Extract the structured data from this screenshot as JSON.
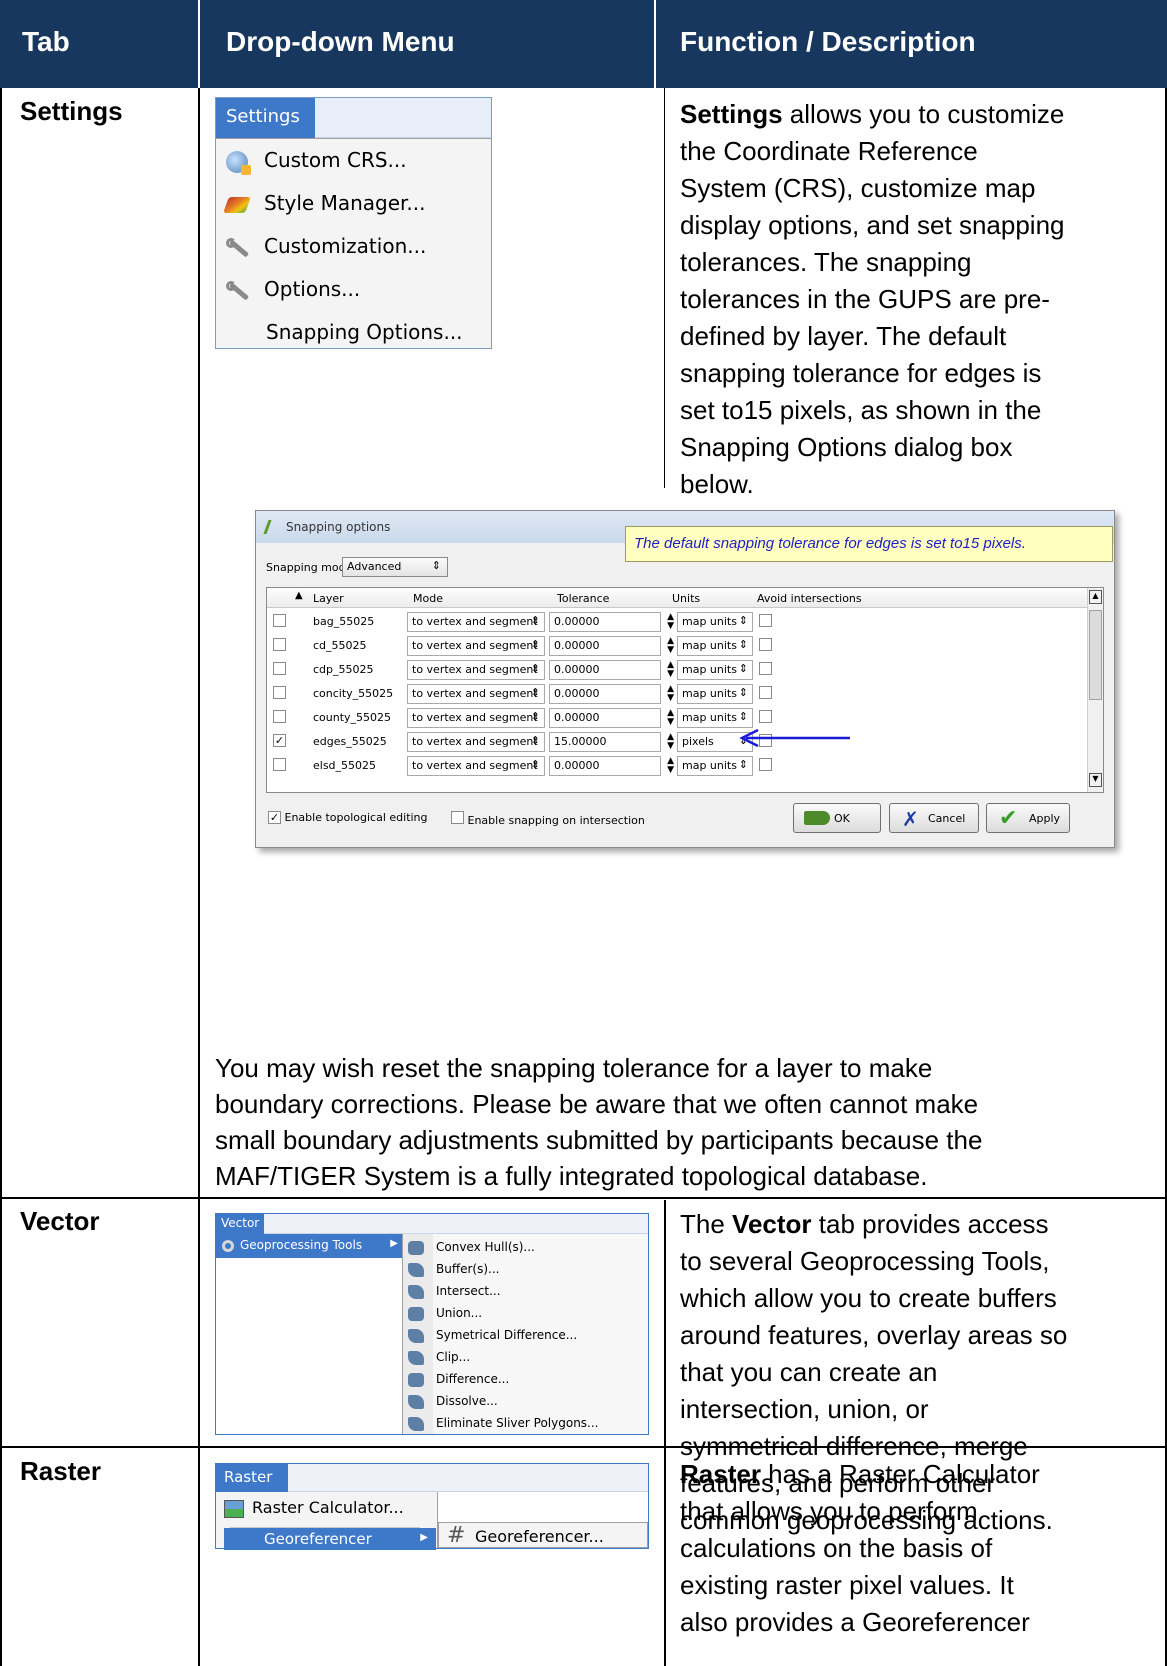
{
  "header": {
    "col1": "Tab",
    "col2": "Drop-down Menu",
    "col3": "Function / Description",
    "bg_color": "#17375e"
  },
  "settings_row": {
    "tab": "Settings",
    "menu_title": "Settings",
    "menu_items": [
      {
        "label": "Custom CRS...",
        "icon": "globe-crs-icon"
      },
      {
        "label": "Style Manager...",
        "icon": "paintbrush-icon"
      },
      {
        "label": "Customization...",
        "icon": "wrench-icon"
      },
      {
        "label": "Options...",
        "icon": "wrench-icon"
      },
      {
        "label": "Snapping Options...",
        "icon": ""
      }
    ],
    "desc_bold": "Settings",
    "desc_lines": [
      " allows you to customize",
      "the Coordinate Reference",
      "System (CRS), customize map",
      "display options, and set snapping",
      "tolerances. The snapping",
      "tolerances in the GUPS are pre-",
      "defined by layer. The default",
      "snapping tolerance for edges is",
      "set to15 pixels, as shown in the",
      "Snapping Options dialog box",
      "below."
    ],
    "dialog": {
      "title": "Snapping options",
      "callout": "The default snapping tolerance for edges is set to15 pixels.",
      "snapping_mode_label": "Snapping mode",
      "snapping_mode_value": "Advanced",
      "columns": [
        "Layer",
        "Mode",
        "Tolerance",
        "Units",
        "Avoid intersections"
      ],
      "rows": [
        {
          "checked": false,
          "layer": "bag_55025",
          "mode": "to vertex and segment",
          "tolerance": "0.00000",
          "units": "map units"
        },
        {
          "checked": false,
          "layer": "cd_55025",
          "mode": "to vertex and segment",
          "tolerance": "0.00000",
          "units": "map units"
        },
        {
          "checked": false,
          "layer": "cdp_55025",
          "mode": "to vertex and segment",
          "tolerance": "0.00000",
          "units": "map units"
        },
        {
          "checked": false,
          "layer": "concity_55025",
          "mode": "to vertex and segment",
          "tolerance": "0.00000",
          "units": "map units"
        },
        {
          "checked": false,
          "layer": "county_55025",
          "mode": "to vertex and segment",
          "tolerance": "0.00000",
          "units": "map units"
        },
        {
          "checked": true,
          "layer": "edges_55025",
          "mode": "to vertex and segment",
          "tolerance": "15.00000",
          "units": "pixels"
        },
        {
          "checked": false,
          "layer": "elsd_55025",
          "mode": "to vertex and segment",
          "tolerance": "0.00000",
          "units": "map units"
        }
      ],
      "enable_topological_label": "Enable topological editing",
      "enable_topological_checked": true,
      "enable_intersection_label": "Enable snapping on intersection",
      "enable_intersection_checked": false,
      "ok_label": "OK",
      "cancel_label": "Cancel",
      "apply_label": "Apply",
      "arrow_color": "#1c1cd8"
    },
    "paragraph_lines": [
      "You may wish reset the snapping tolerance for a layer to make",
      "boundary corrections. Please be aware that we often cannot make",
      "small boundary adjustments submitted by participants because the",
      "MAF/TIGER System is a fully integrated topological database."
    ]
  },
  "vector_row": {
    "tab": "Vector",
    "menu_title": "Vector",
    "submenu_label": "Geoprocessing Tools",
    "submenu_items": [
      "Convex Hull(s)...",
      "Buffer(s)...",
      "Intersect...",
      "Union...",
      "Symetrical Difference...",
      "Clip...",
      "Difference...",
      "Dissolve...",
      "Eliminate Sliver Polygons..."
    ],
    "desc_prefix": "The ",
    "desc_bold": "Vector",
    "desc_lines": [
      " tab provides access",
      "to several Geoprocessing Tools,",
      "which allow you to create buffers",
      "around features, overlay areas so",
      "that you can create an",
      "intersection, union, or",
      "symmetrical difference, merge",
      "features, and perform other",
      "common geoprocessing actions."
    ]
  },
  "raster_row": {
    "tab": "Raster",
    "menu_title": "Raster",
    "item1": "Raster Calculator...",
    "submenu_label": "Georeferencer",
    "submenu_item": "Georeferencer...",
    "desc_bold": "Raster",
    "desc_lines": [
      " has a Raster Calculator",
      "that allows you to perform",
      "calculations on the basis of",
      "existing raster pixel values. It",
      "also provides a Georeferencer"
    ]
  }
}
